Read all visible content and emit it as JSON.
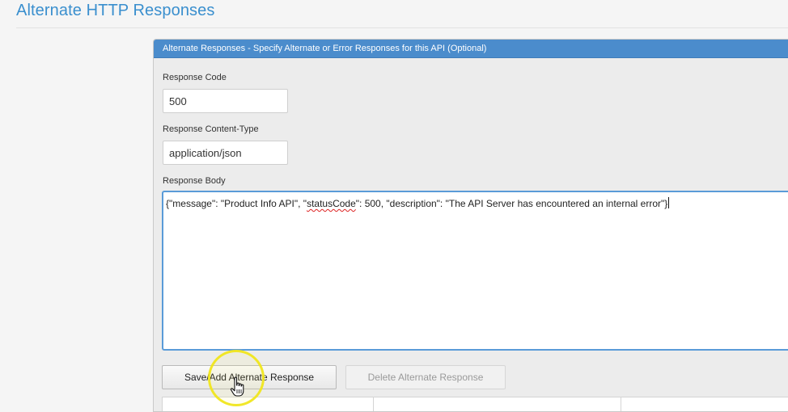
{
  "page": {
    "title": "Alternate HTTP Responses"
  },
  "panel": {
    "header": "Alternate Responses - Specify Alternate or Error Responses for this API (Optional)"
  },
  "form": {
    "response_code_label": "Response Code",
    "response_code_value": "500",
    "content_type_label": "Response Content-Type",
    "content_type_value": "application/json",
    "body_label": "Response Body",
    "body_part1": "{\"message\": \"Product Info API\", \"",
    "body_misspelled": "statusCode",
    "body_part2": "\": 500, \"description\": \"The API Server has encountered an internal error\"}"
  },
  "buttons": {
    "save_label": "Save/Add Alternate Response",
    "delete_label": "Delete Alternate Response"
  },
  "icons": {
    "cursor": "hand-pointer-icon",
    "highlight": "click-highlight-ring"
  },
  "colors": {
    "accent": "#3a8fce",
    "header_bg": "#4b8ccc",
    "focus_border": "#5a9bd8",
    "highlight": "#f0e61e"
  }
}
